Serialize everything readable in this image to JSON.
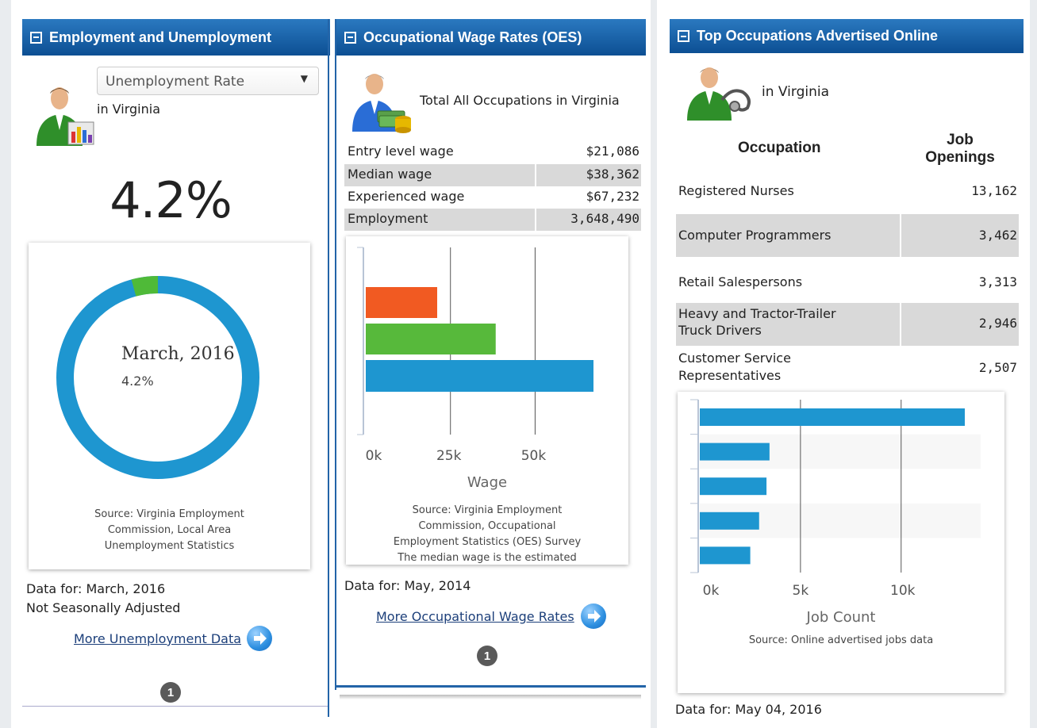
{
  "panel1": {
    "title": "Employment and Unemployment",
    "select_value": "Unemployment Rate",
    "location": "in Virginia",
    "big_value": "4.2%",
    "donut_date": "March, 2016",
    "donut_value": "4.2%",
    "donut_fraction": 0.042,
    "source": [
      "Source: Virginia Employment",
      "Commission, Local Area",
      "Unemployment Statistics"
    ],
    "data_for": "Data for: March, 2016",
    "adjust": "Not Seasonally Adjusted",
    "more_link": "More Unemployment Data",
    "page": "1",
    "colors": {
      "main": "#1e96d0",
      "accent": "#4fba38"
    }
  },
  "panel2": {
    "title": "Occupational Wage Rates (OES)",
    "subtitle": "Total All Occupations in Virginia",
    "rows": [
      {
        "label": "Entry level wage",
        "value": "$21,086"
      },
      {
        "label": "Median wage",
        "value": "$38,362"
      },
      {
        "label": "Experienced wage",
        "value": "$67,232"
      },
      {
        "label": "Employment",
        "value": "3,648,490"
      }
    ],
    "source": [
      "Source: Virginia Employment",
      "Commission, Occupational",
      "Employment Statistics (OES) Survey",
      "The median wage is the estimated"
    ],
    "data_for": "Data for: May, 2014",
    "more_link": "More Occupational Wage Rates",
    "page": "1"
  },
  "panel3": {
    "title": "Top Occupations Advertised Online",
    "location": "in Virginia",
    "col_occupation": "Occupation",
    "col_openings_1": "Job",
    "col_openings_2": "Openings",
    "rows": [
      {
        "name_1": "Registered Nurses",
        "name_2": "",
        "value": "13,162"
      },
      {
        "name_1": "Computer Programmers",
        "name_2": "",
        "value": "3,462"
      },
      {
        "name_1": "Retail Salespersons",
        "name_2": "",
        "value": "3,313"
      },
      {
        "name_1": "Heavy and Tractor-Trailer",
        "name_2": "Truck Drivers",
        "value": "2,946"
      },
      {
        "name_1": "Customer Service",
        "name_2": "Representatives",
        "value": "2,507"
      }
    ],
    "source": "Source: Online advertised jobs data",
    "data_for": "Data for: May 04, 2016"
  },
  "chart_data": [
    {
      "type": "bar",
      "orientation": "horizontal",
      "categories": [
        "Entry level wage",
        "Median wage",
        "Experienced wage"
      ],
      "values": [
        21086,
        38362,
        67232
      ],
      "colors": [
        "#f15a22",
        "#57b93b",
        "#1e96d0"
      ],
      "xlabel": "Wage",
      "xticks": [
        "0k",
        "25k",
        "50k"
      ],
      "xlim": [
        0,
        67232
      ],
      "grid": true
    },
    {
      "type": "bar",
      "orientation": "horizontal",
      "categories": [
        "Registered Nurses",
        "Computer Programmers",
        "Retail Salespersons",
        "Heavy and Tractor-Trailer Truck Drivers",
        "Customer Service Representatives"
      ],
      "values": [
        13162,
        3462,
        3313,
        2946,
        2507
      ],
      "color": "#1e96d0",
      "xlabel": "Job Count",
      "xticks": [
        "0k",
        "5k",
        "10k"
      ],
      "xlim": [
        0,
        13162
      ],
      "grid": true
    }
  ]
}
